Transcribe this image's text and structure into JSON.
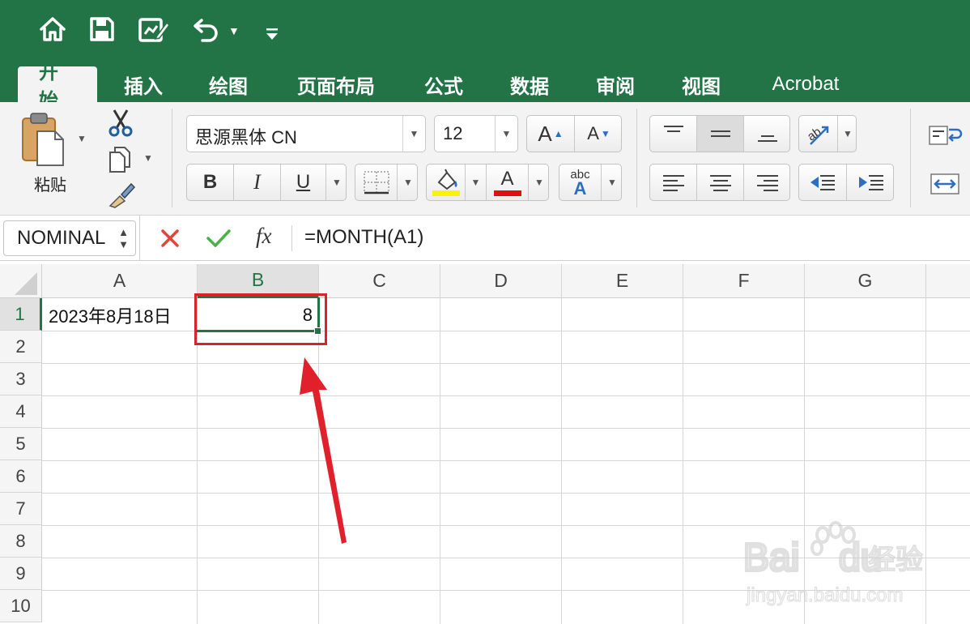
{
  "quick_access": {
    "icons": [
      "home-icon",
      "save-icon",
      "edit-document-icon",
      "undo-icon",
      "customize-toolbar-icon"
    ]
  },
  "tabs": [
    {
      "label": "开始",
      "active": true
    },
    {
      "label": "插入",
      "active": false
    },
    {
      "label": "绘图",
      "active": false
    },
    {
      "label": "页面布局",
      "active": false
    },
    {
      "label": "公式",
      "active": false
    },
    {
      "label": "数据",
      "active": false
    },
    {
      "label": "审阅",
      "active": false
    },
    {
      "label": "视图",
      "active": false
    },
    {
      "label": "Acrobat",
      "active": false
    }
  ],
  "ribbon": {
    "paste_label": "粘贴",
    "font_name": "思源黑体 CN",
    "font_size": "12",
    "bold": "B",
    "italic": "I",
    "underline": "U",
    "grow_font_glyph": "A",
    "shrink_font_glyph": "A",
    "wrap_text_glyph": "abc",
    "wrap_text_glyph_big": "A",
    "font_color_glyph": "A",
    "fill_color": "#f7f407",
    "font_color": "#e01010"
  },
  "formula_bar": {
    "name_box": "NOMINAL",
    "fx": "fx",
    "formula": "=MONTH(A1)"
  },
  "sheet": {
    "columns": [
      "A",
      "B",
      "C",
      "D",
      "E",
      "F",
      "G"
    ],
    "rows": [
      "1",
      "2",
      "3",
      "4",
      "5",
      "6",
      "7",
      "8",
      "9",
      "10"
    ],
    "selected_column": "B",
    "selected_row": "1",
    "cells": {
      "A1": "2023年8月18日",
      "B1": "8"
    }
  },
  "annotation": {
    "highlight_color": "#d8232a",
    "arrow_color": "#e0212b"
  },
  "watermark": {
    "brand": "Baidu经验",
    "url": "jingyan.baidu.com"
  },
  "colors": {
    "accent": "#227446"
  }
}
